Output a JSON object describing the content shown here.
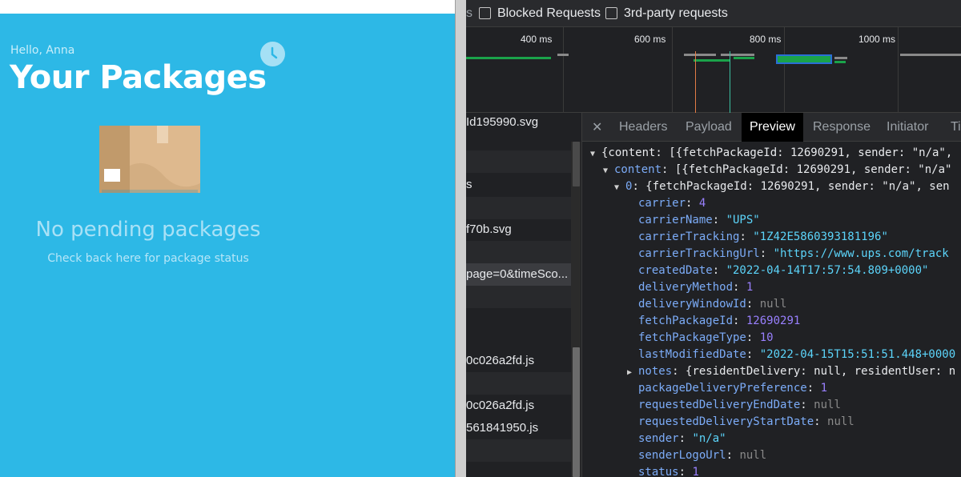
{
  "app": {
    "greeting": "Hello, Anna",
    "title": "Your Packages",
    "empty_title": "No pending packages",
    "empty_subtitle": "Check back here for package status",
    "colors": {
      "background": "#2db8e6",
      "title": "#ffffff"
    },
    "icons": {
      "history": "clock-icon",
      "illustration": "package-box-icon"
    }
  },
  "devtools": {
    "filterbar": {
      "truncated_label": "s",
      "blocked_requests": "Blocked Requests",
      "third_party": "3rd-party requests"
    },
    "timeline": {
      "ticks": [
        "400 ms",
        "600 ms",
        "800 ms",
        "1000 ms"
      ]
    },
    "requests": [
      "Id195990.svg",
      "",
      "s",
      "",
      "f70b.svg",
      "",
      "page=0&timeSco...",
      "",
      "",
      "0c026a2fd.js",
      "",
      "0c026a2fd.js",
      "561841950.js",
      "",
      ""
    ],
    "tabs": {
      "close": "✕",
      "headers": "Headers",
      "payload": "Payload",
      "preview": "Preview",
      "response": "Response",
      "initiator": "Initiator",
      "timing": "Ti"
    },
    "preview": {
      "root": "{content: [{fetchPackageId: 12690291, sender: \"n/a\",",
      "content_key": "content",
      "content_summary": "[{fetchPackageId: 12690291, sender: \"n/a\"",
      "item_index": "0",
      "item_summary": "{fetchPackageId: 12690291, sender: \"n/a\", sen",
      "fields": [
        {
          "key": "carrier",
          "value": "4",
          "type": "number"
        },
        {
          "key": "carrierName",
          "value": "\"UPS\"",
          "type": "string"
        },
        {
          "key": "carrierTracking",
          "value": "\"1Z42E5860393181196\"",
          "type": "string"
        },
        {
          "key": "carrierTrackingUrl",
          "value": "\"https://www.ups.com/track",
          "type": "string"
        },
        {
          "key": "createdDate",
          "value": "\"2022-04-14T17:57:54.809+0000\"",
          "type": "string"
        },
        {
          "key": "deliveryMethod",
          "value": "1",
          "type": "number"
        },
        {
          "key": "deliveryWindowId",
          "value": "null",
          "type": "null"
        },
        {
          "key": "fetchPackageId",
          "value": "12690291",
          "type": "number"
        },
        {
          "key": "fetchPackageType",
          "value": "10",
          "type": "number"
        },
        {
          "key": "lastModifiedDate",
          "value": "\"2022-04-15T15:51:51.448+0000",
          "type": "string"
        },
        {
          "key": "notes",
          "value": "{residentDelivery: null, residentUser: n",
          "type": "object"
        },
        {
          "key": "packageDeliveryPreference",
          "value": "1",
          "type": "number"
        },
        {
          "key": "requestedDeliveryEndDate",
          "value": "null",
          "type": "null"
        },
        {
          "key": "requestedDeliveryStartDate",
          "value": "null",
          "type": "null"
        },
        {
          "key": "sender",
          "value": "\"n/a\"",
          "type": "string"
        },
        {
          "key": "senderLogoUrl",
          "value": "null",
          "type": "null"
        },
        {
          "key": "status",
          "value": "1",
          "type": "number"
        }
      ]
    }
  }
}
